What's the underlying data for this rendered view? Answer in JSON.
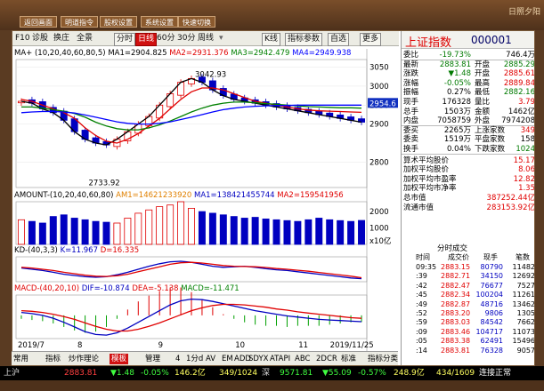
{
  "top_buttons": [
    "返回画面",
    "明道指令",
    "股权设置",
    "系统设置",
    "快速切换"
  ],
  "logo_text": "日照夕阳",
  "toolbar": {
    "items": [
      "F10",
      "诊股",
      "换庄",
      "全景",
      "分时",
      "日线",
      "60分",
      "30分",
      "周线",
      "K线",
      "指标参数",
      "自选",
      "更多"
    ],
    "selected": "日线"
  },
  "ma_line": {
    "prefix": "MA+ (10,20,40,60,80,5)",
    "ma1": "MA1=2904.825",
    "ma2": "MA2=2931.376",
    "ma3": "MA3=2942.479",
    "ma4": "MA4=2949.938"
  },
  "kline_labels": {
    "high": "3042.93",
    "low": "2733.92",
    "current": "2954.6"
  },
  "price_axis": [
    "3050",
    "3000",
    "2950",
    "2900",
    "2800"
  ],
  "amount_line": {
    "prefix": "AMOUNT-(10,20,40,60,80)",
    "am1": "AM1=14621233920",
    "ma1": "MA1=138421455744",
    "ma2": "MA2=159541956"
  },
  "amount_axis": [
    "2000",
    "1000",
    "x10亿"
  ],
  "kd_line": {
    "prefix": "KD-(40,3,3)",
    "k": "K=11.967",
    "d": "D=16.335"
  },
  "macd_line": {
    "prefix": "MACD-(40,20,10)",
    "dif": "DIF=-10.874",
    "dea": "DEA=-5.138",
    "macd": "MACD=-11.471"
  },
  "date_axis": [
    "2019/7",
    "8",
    "9",
    "10",
    "11",
    "2019/11/25"
  ],
  "bottom_nav": [
    "常用",
    "指标",
    "炒作理论",
    "模板",
    "管理",
    "4",
    "1分d",
    "AV",
    "EM",
    "ADD",
    "SDYX",
    "ATAPI",
    "ABC",
    "2DCR",
    "标准",
    "指标分类"
  ],
  "bottom_nav_selected": "模板",
  "quote": {
    "name": "上证指数",
    "code": "000001",
    "rows": [
      {
        "l1": "委比",
        "v1": "-19.73%",
        "c1": "grn",
        "l2": "",
        "v2": "746.4万",
        "c2": "blk"
      },
      {
        "l1": "最新",
        "v1": "2883.81",
        "c1": "grn",
        "l2": "开盘",
        "v2": "2885.29",
        "c2": "grn"
      },
      {
        "l1": "涨跌",
        "v1": "▼1.48",
        "c1": "grn",
        "l2": "开盘",
        "v2": "2885.61",
        "c2": "red"
      },
      {
        "l1": "涨幅",
        "v1": "-0.05%",
        "c1": "grn",
        "l2": "最高",
        "v2": "2889.84",
        "c2": "red"
      },
      {
        "l1": "振幅",
        "v1": "0.27%",
        "c1": "blk",
        "l2": "最低",
        "v2": "2882.16",
        "c2": "grn"
      },
      {
        "l1": "现手",
        "v1": "176328",
        "c1": "blk",
        "l2": "量比",
        "v2": "3.79",
        "c2": "red"
      },
      {
        "l1": "总手",
        "v1": "1503万",
        "c1": "blk",
        "l2": "金额",
        "v2": "1462亿",
        "c2": "blk"
      },
      {
        "l1": "内盘",
        "v1": "7058759",
        "c1": "blk",
        "l2": "外盘",
        "v2": "7974208",
        "c2": "blk"
      },
      {
        "l1": "委买",
        "v1": "2265万",
        "c1": "blk",
        "l2": "上涨家数",
        "v2": "349",
        "c2": "red"
      },
      {
        "l1": "委卖",
        "v1": "1519万",
        "c1": "blk",
        "l2": "平盘家数",
        "v2": "158",
        "c2": "blk"
      },
      {
        "l1": "换手",
        "v1": "0.04%",
        "c1": "blk",
        "l2": "下跌家数",
        "v2": "1024",
        "c2": "grn"
      }
    ],
    "stats": [
      {
        "l": "算术平均股价",
        "v": "15.17",
        "c": "red"
      },
      {
        "l": "加权平均股价",
        "v": "8.06",
        "c": "red"
      },
      {
        "l": "加权平均市盈率",
        "v": "12.82",
        "c": "red"
      },
      {
        "l": "加权平均市净率",
        "v": "1.35",
        "c": "red"
      },
      {
        "l": "总市值",
        "v": "387252.44亿",
        "c": "red"
      },
      {
        "l": "流通市值",
        "v": "283153.92亿",
        "c": "red"
      }
    ],
    "tick_title": "分时成交",
    "tick_headers": [
      "时间",
      "成交价",
      "现手",
      "笔数"
    ],
    "ticks": [
      {
        "t": "09:35",
        "p": "2883.15",
        "v": "80790",
        "n": "11482"
      },
      {
        "t": ":39",
        "p": "2882.71",
        "v": "34150",
        "n": "12692"
      },
      {
        "t": ":42",
        "p": "2882.47",
        "v": "76677",
        "n": "7527"
      },
      {
        "t": ":45",
        "p": "2882.34",
        "v": "100204",
        "n": "11261"
      },
      {
        "t": ":49",
        "p": "2882.87",
        "v": "48716",
        "n": "13462"
      },
      {
        "t": ":52",
        "p": "2883.20",
        "v": "9806",
        "n": "1305"
      },
      {
        "t": ":59",
        "p": "2883.03",
        "v": "84542",
        "n": "7662"
      },
      {
        "t": ":09",
        "p": "2883.46",
        "v": "104717",
        "n": "11073"
      },
      {
        "t": ":05",
        "p": "2883.38",
        "v": "62491",
        "n": "15496"
      },
      {
        "t": ":14",
        "p": "2883.81",
        "v": "76328",
        "n": "9057"
      }
    ],
    "tabs": [
      "分笔",
      "分时",
      "短线"
    ]
  },
  "status_bar": {
    "label": "上沪",
    "index": "2883.81",
    "change": "▼1.48",
    "pct": "-0.05%",
    "amount": "146.2亿",
    "ratio": "349/1024",
    "label2": "深",
    "index2": "9571.81",
    "change2": "▼55.09",
    "pct2": "-0.57%",
    "amount2": "248.9亿",
    "ratio2": "434/1609",
    "link": "连接正常"
  },
  "colors": {
    "up": "#e00000",
    "down": "#0000c0",
    "ma1": "#000000",
    "ma2": "#e00000",
    "ma3": "#008000",
    "ma4": "#0000ff"
  },
  "chart_data": [
    {
      "type": "candlestick",
      "title": "",
      "series": [
        {
          "name": "MA1",
          "values": [
            2960,
            2955,
            2940,
            2930,
            2910,
            2880,
            2860,
            2850,
            2845,
            2860,
            2880,
            2900,
            2920,
            2950,
            2980,
            3010,
            3020,
            3010,
            2990,
            2975,
            2965,
            2960,
            2955,
            2950,
            2945,
            2940,
            2935,
            2930,
            2925,
            2920,
            2915,
            2910,
            2905
          ]
        },
        {
          "name": "MA2",
          "values": [
            2965,
            2960,
            2950,
            2940,
            2930,
            2915,
            2890,
            2870,
            2855,
            2850,
            2860,
            2875,
            2895,
            2915,
            2940,
            2965,
            2985,
            2995,
            2995,
            2990,
            2980,
            2970,
            2960,
            2955,
            2950,
            2945,
            2940,
            2937,
            2935,
            2934,
            2933,
            2932,
            2931
          ]
        },
        {
          "name": "MA3",
          "values": [
            2945,
            2945,
            2942,
            2938,
            2934,
            2928,
            2918,
            2905,
            2895,
            2888,
            2885,
            2885,
            2890,
            2898,
            2908,
            2920,
            2932,
            2942,
            2950,
            2955,
            2958,
            2958,
            2956,
            2954,
            2952,
            2950,
            2948,
            2946,
            2945,
            2944,
            2943,
            2943,
            2942
          ]
        },
        {
          "name": "MA4",
          "values": [
            2930,
            2932,
            2933,
            2933,
            2932,
            2929,
            2924,
            2918,
            2912,
            2906,
            2902,
            2900,
            2900,
            2902,
            2906,
            2912,
            2918,
            2925,
            2932,
            2938,
            2942,
            2945,
            2947,
            2948,
            2949,
            2949,
            2950,
            2950,
            2950,
            2950,
            2950,
            2950,
            2950
          ]
        }
      ],
      "high_marker": 3042.93,
      "low_marker": 2733.92,
      "ylim": [
        2733,
        3070
      ]
    },
    {
      "type": "bar",
      "title": "",
      "values": [
        1500,
        1400,
        1300,
        1700,
        1800,
        1600,
        1500,
        1400,
        1350,
        1300,
        1600,
        1900,
        2100,
        2300,
        2400,
        2600,
        2200,
        2000,
        1900,
        1800,
        1700,
        1600,
        1650,
        1550,
        1500,
        1450,
        1400,
        1500,
        1600,
        1500,
        1450,
        1400,
        1460
      ],
      "ylim": [
        0,
        2600
      ]
    },
    {
      "type": "line",
      "title": "",
      "series": [
        {
          "name": "K",
          "values": [
            55,
            50,
            45,
            38,
            30,
            25,
            20,
            18,
            20,
            28,
            38,
            50,
            62,
            72,
            80,
            82,
            78,
            70,
            62,
            58,
            60,
            62,
            58,
            52,
            48,
            45,
            40,
            35,
            30,
            25,
            20,
            15,
            12
          ]
        },
        {
          "name": "D",
          "values": [
            58,
            55,
            50,
            45,
            38,
            32,
            26,
            22,
            21,
            24,
            30,
            40,
            50,
            60,
            70,
            76,
            78,
            75,
            70,
            65,
            62,
            61,
            60,
            57,
            53,
            50,
            46,
            42,
            37,
            32,
            27,
            22,
            16
          ]
        }
      ],
      "ylim": [
        0,
        100
      ]
    },
    {
      "type": "line",
      "title": "",
      "series": [
        {
          "name": "DIF",
          "values": [
            5,
            3,
            0,
            -5,
            -12,
            -20,
            -28,
            -33,
            -34,
            -30,
            -22,
            -12,
            -2,
            8,
            18,
            25,
            28,
            27,
            24,
            20,
            16,
            12,
            8,
            5,
            2,
            -1,
            -3,
            -5,
            -7,
            -8,
            -9,
            -10,
            -10.874
          ]
        },
        {
          "name": "DEA",
          "values": [
            8,
            7,
            5,
            2,
            -2,
            -7,
            -13,
            -19,
            -24,
            -27,
            -27,
            -24,
            -19,
            -13,
            -6,
            1,
            8,
            13,
            17,
            19,
            19,
            18,
            16,
            14,
            11,
            9,
            6,
            4,
            2,
            0,
            -2,
            -4,
            -5.138
          ]
        }
      ],
      "ylim": [
        -40,
        35
      ]
    }
  ]
}
